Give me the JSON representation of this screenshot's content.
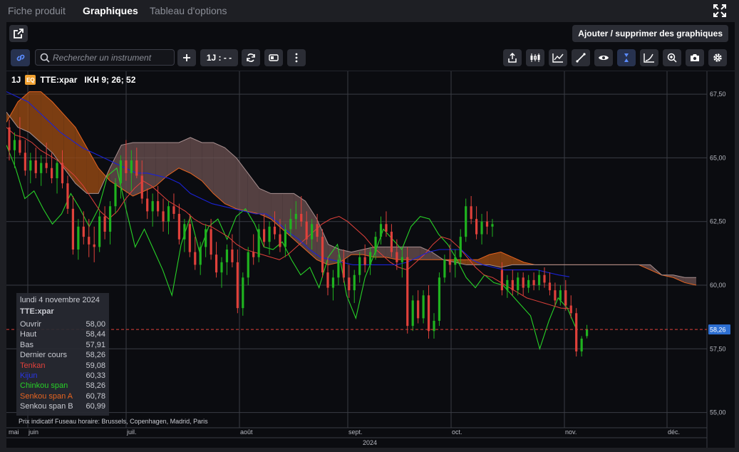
{
  "tabs": [
    {
      "label": "Fiche produit",
      "active": false
    },
    {
      "label": "Graphiques",
      "active": true
    },
    {
      "label": "Tableau d'options",
      "active": false
    }
  ],
  "toolbar": {
    "add_charts_label": "Ajouter / supprimer des graphiques",
    "search_placeholder": "Rechercher un instrument",
    "interval_label": "1J : - -",
    "right_icons": [
      "share-icon",
      "candlestick-type-icon",
      "indicators-icon",
      "draw-line-icon",
      "visibility-icon",
      "crosshair-icon",
      "trend-icon",
      "zoom-icon",
      "screenshot-icon",
      "settings-icon"
    ]
  },
  "chart": {
    "interval": "1J",
    "symbol": "TTE:xpar",
    "symbol_badge": "EQ",
    "indicator": "IKH 9; 26; 52",
    "last_price_label": "58,26",
    "year_label": "2024",
    "footer_note": "Prix indicatif    Fuseau horaire: Brussels, Copenhagen, Madrid, Paris",
    "colors": {
      "candle_up": "#1fb31f",
      "candle_down": "#e0413b",
      "tenkan": "#e0413b",
      "kijun": "#1a22d6",
      "chinkou": "#27d127",
      "senkou_a": "#e76420",
      "senkou_b": "#8d7070",
      "price_line": "#e0413b",
      "price_badge": "#2d6fd2"
    }
  },
  "tooltip": {
    "date": "lundi 4 novembre 2024",
    "symbol": "TTE:xpar",
    "rows": [
      {
        "label": "Ouvrir",
        "value": "58,00",
        "color": "#c9cbd2"
      },
      {
        "label": "Haut",
        "value": "58,44",
        "color": "#c9cbd2"
      },
      {
        "label": "Bas",
        "value": "57,91",
        "color": "#c9cbd2"
      },
      {
        "label": "Dernier cours",
        "value": "58,26",
        "color": "#c9cbd2"
      },
      {
        "label": "Tenkan",
        "value": "59,08",
        "color": "#e0413b"
      },
      {
        "label": "Kijun",
        "value": "60,33",
        "color": "#2a36e8"
      },
      {
        "label": "Chinkou span",
        "value": "58,26",
        "color": "#27d127"
      },
      {
        "label": "Senkou span A",
        "value": "60,78",
        "color": "#e76420"
      },
      {
        "label": "Senkou span B",
        "value": "60,99",
        "color": "#c9cbd2"
      }
    ]
  },
  "chart_data": {
    "type": "candlestick",
    "y_ticks": [
      "67,50",
      "65,00",
      "62,50",
      "60,00",
      "57,50",
      "55,00"
    ],
    "x_ticks": [
      "mai",
      "juin",
      "juil.",
      "août",
      "sept.",
      "oct.",
      "nov.",
      "déc."
    ],
    "ylim": [
      54.4,
      68.4
    ],
    "grid": true,
    "candles_ohlc": [
      [
        66.2,
        66.5,
        64.9,
        65.3
      ],
      [
        65.3,
        66.0,
        64.6,
        65.7
      ],
      [
        65.7,
        66.6,
        65.1,
        65.2
      ],
      [
        65.2,
        65.7,
        64.3,
        64.5
      ],
      [
        64.5,
        65.2,
        64.0,
        64.9
      ],
      [
        64.9,
        65.4,
        64.2,
        64.4
      ],
      [
        64.4,
        65.1,
        63.9,
        64.8
      ],
      [
        64.8,
        65.6,
        64.4,
        64.6
      ],
      [
        64.6,
        65.2,
        64.0,
        64.2
      ],
      [
        64.2,
        64.9,
        63.6,
        64.8
      ],
      [
        64.8,
        65.3,
        63.8,
        64.0
      ],
      [
        64.0,
        64.3,
        62.8,
        63.0
      ],
      [
        63.0,
        63.5,
        61.2,
        61.4
      ],
      [
        61.4,
        62.6,
        61.0,
        62.3
      ],
      [
        62.3,
        62.9,
        61.6,
        61.9
      ],
      [
        61.9,
        62.6,
        61.1,
        61.6
      ],
      [
        61.6,
        62.3,
        60.9,
        61.5
      ],
      [
        61.5,
        62.9,
        61.3,
        62.7
      ],
      [
        62.7,
        63.1,
        61.8,
        62.1
      ],
      [
        62.1,
        63.3,
        61.6,
        63.1
      ],
      [
        63.1,
        64.2,
        62.8,
        64.0
      ],
      [
        64.0,
        65.1,
        63.4,
        64.9
      ],
      [
        64.9,
        65.7,
        64.1,
        64.4
      ],
      [
        64.4,
        65.3,
        63.7,
        64.9
      ],
      [
        64.9,
        65.4,
        64.2,
        64.3
      ],
      [
        64.3,
        64.9,
        63.2,
        63.4
      ],
      [
        63.4,
        63.8,
        62.6,
        62.9
      ],
      [
        62.9,
        63.6,
        62.3,
        63.3
      ],
      [
        63.3,
        63.9,
        62.7,
        62.9
      ],
      [
        62.9,
        63.4,
        62.1,
        62.5
      ],
      [
        62.5,
        63.3,
        62.0,
        63.1
      ],
      [
        63.1,
        63.6,
        62.6,
        62.8
      ],
      [
        62.8,
        63.2,
        61.6,
        61.8
      ],
      [
        61.8,
        62.6,
        61.3,
        62.4
      ],
      [
        62.4,
        62.8,
        61.1,
        61.3
      ],
      [
        61.3,
        61.9,
        60.6,
        60.8
      ],
      [
        60.8,
        61.7,
        60.4,
        61.5
      ],
      [
        61.5,
        62.4,
        61.1,
        62.2
      ],
      [
        62.2,
        62.6,
        61.0,
        61.2
      ],
      [
        61.2,
        61.7,
        60.3,
        60.5
      ],
      [
        60.5,
        61.1,
        59.9,
        60.9
      ],
      [
        60.9,
        61.6,
        60.4,
        61.4
      ],
      [
        61.4,
        62.0,
        60.7,
        60.9
      ],
      [
        60.9,
        61.4,
        58.9,
        59.1
      ],
      [
        59.1,
        60.5,
        58.8,
        60.3
      ],
      [
        60.3,
        61.5,
        60.0,
        61.3
      ],
      [
        61.3,
        62.0,
        60.8,
        61.1
      ],
      [
        61.1,
        62.4,
        60.9,
        62.2
      ],
      [
        62.2,
        62.8,
        61.5,
        61.7
      ],
      [
        61.7,
        62.5,
        61.2,
        62.3
      ],
      [
        62.3,
        62.9,
        61.8,
        62.0
      ],
      [
        62.0,
        62.6,
        61.3,
        61.5
      ],
      [
        61.5,
        62.4,
        61.1,
        62.2
      ],
      [
        62.2,
        63.0,
        61.9,
        62.6
      ],
      [
        62.6,
        63.3,
        62.2,
        62.8
      ],
      [
        62.8,
        63.5,
        62.3,
        62.5
      ],
      [
        62.5,
        62.9,
        61.6,
        61.8
      ],
      [
        61.8,
        62.6,
        61.4,
        62.4
      ],
      [
        62.4,
        62.8,
        61.7,
        61.9
      ],
      [
        61.9,
        62.2,
        60.3,
        60.5
      ],
      [
        60.5,
        61.1,
        59.6,
        59.9
      ],
      [
        59.9,
        60.6,
        59.4,
        60.3
      ],
      [
        60.3,
        61.2,
        60.0,
        61.0
      ],
      [
        61.0,
        61.4,
        60.1,
        60.3
      ],
      [
        60.3,
        60.8,
        59.5,
        59.8
      ],
      [
        59.8,
        60.6,
        59.3,
        60.4
      ],
      [
        60.4,
        61.3,
        60.1,
        61.1
      ],
      [
        61.1,
        61.6,
        60.5,
        60.8
      ],
      [
        60.8,
        61.5,
        60.4,
        61.3
      ],
      [
        61.3,
        62.1,
        61.0,
        61.9
      ],
      [
        61.9,
        62.7,
        61.6,
        62.4
      ],
      [
        62.4,
        62.9,
        61.9,
        62.1
      ],
      [
        62.1,
        62.4,
        61.1,
        61.3
      ],
      [
        61.3,
        61.8,
        60.6,
        60.9
      ],
      [
        60.9,
        61.4,
        60.3,
        61.1
      ],
      [
        61.1,
        61.5,
        58.1,
        58.4
      ],
      [
        58.4,
        59.6,
        58.2,
        59.4
      ],
      [
        59.4,
        59.8,
        58.5,
        58.7
      ],
      [
        58.7,
        59.8,
        58.5,
        59.6
      ],
      [
        59.6,
        60.0,
        57.9,
        58.2
      ],
      [
        58.2,
        58.9,
        57.9,
        58.6
      ],
      [
        58.6,
        60.5,
        58.4,
        60.3
      ],
      [
        60.3,
        61.2,
        60.1,
        61.0
      ],
      [
        61.0,
        61.6,
        60.5,
        60.8
      ],
      [
        60.8,
        61.4,
        60.3,
        61.1
      ],
      [
        61.1,
        62.2,
        60.8,
        61.9
      ],
      [
        61.9,
        63.4,
        61.7,
        63.1
      ],
      [
        63.1,
        63.5,
        62.4,
        62.6
      ],
      [
        62.6,
        63.1,
        61.8,
        62.0
      ],
      [
        62.0,
        62.8,
        61.6,
        62.5
      ],
      [
        62.5,
        62.9,
        62.0,
        62.3
      ],
      [
        62.3,
        62.6,
        61.9,
        62.4
      ],
      [
        60.6,
        60.9,
        59.6,
        59.8
      ],
      [
        59.8,
        60.4,
        59.5,
        60.2
      ],
      [
        60.2,
        60.6,
        59.6,
        59.8
      ],
      [
        59.8,
        60.5,
        59.6,
        60.3
      ],
      [
        60.3,
        60.5,
        59.6,
        59.9
      ],
      [
        59.9,
        60.4,
        59.7,
        60.2
      ],
      [
        60.2,
        60.5,
        59.8,
        60.0
      ],
      [
        60.0,
        60.6,
        59.8,
        60.4
      ],
      [
        60.4,
        60.7,
        59.9,
        60.1
      ],
      [
        60.1,
        60.5,
        59.6,
        59.8
      ],
      [
        59.8,
        60.1,
        59.2,
        59.4
      ],
      [
        59.4,
        60.0,
        59.2,
        59.8
      ],
      [
        59.8,
        60.2,
        59.0,
        59.2
      ],
      [
        59.2,
        59.6,
        58.7,
        58.9
      ],
      [
        58.9,
        59.1,
        57.2,
        57.4
      ],
      [
        57.4,
        58.0,
        57.2,
        57.9
      ],
      [
        58.0,
        58.44,
        57.91,
        58.26
      ]
    ],
    "tenkan": [
      66.2,
      65.9,
      65.8,
      65.6,
      65.3,
      65.1,
      64.9,
      64.6,
      64.3,
      63.9,
      63.4,
      62.9,
      62.6,
      62.9,
      63.4,
      63.8,
      64.1,
      63.9,
      63.6,
      63.3,
      63.1,
      62.9,
      62.6,
      62.4,
      62.3,
      62.1,
      61.9,
      61.6,
      61.4,
      61.3,
      61.2,
      61.1,
      61.0,
      61.2,
      61.5,
      61.8,
      62.1,
      62.4,
      62.6,
      62.7,
      62.5,
      62.2,
      61.9,
      61.5,
      61.2,
      60.9,
      60.7,
      60.6,
      60.9,
      61.2,
      61.6,
      61.9,
      61.8,
      61.5,
      61.1,
      60.7,
      60.4,
      60.3,
      60.1,
      59.9,
      59.7,
      59.5,
      59.4,
      59.3,
      59.2,
      59.1,
      59.08
    ],
    "kijun": [
      67.6,
      67.4,
      67.2,
      66.8,
      66.4,
      66.0,
      65.7,
      65.4,
      65.2,
      65.0,
      64.8,
      64.6,
      64.4,
      64.4,
      64.3,
      64.2,
      64.0,
      63.6,
      63.4,
      63.2,
      63.1,
      63.0,
      62.9,
      62.8,
      62.8,
      62.5,
      62.1,
      61.8,
      61.4,
      61.1,
      61.0,
      60.9,
      60.8,
      60.8,
      60.8,
      60.8,
      60.8,
      60.9,
      61.1,
      61.3,
      61.4,
      61.4,
      61.4,
      61.0,
      60.8,
      60.7,
      60.6,
      60.6,
      60.6,
      60.6,
      60.5,
      60.4,
      60.33
    ],
    "chinkou": [
      65.5,
      64.6,
      63.4,
      63.7,
      63.0,
      62.4,
      62.8,
      63.6,
      63.0,
      62.3,
      63.0,
      64.3,
      64.6,
      63.0,
      61.5,
      62.2,
      61.4,
      60.6,
      59.6,
      61.6,
      62.7,
      61.3,
      62.3,
      62.6,
      61.8,
      62.7,
      63.0,
      62.4,
      61.5,
      61.4,
      61.7,
      61.0,
      60.4,
      60.7,
      59.9,
      61.1,
      61.6,
      59.6,
      58.7,
      60.3,
      61.2,
      62.2,
      61.8,
      61.4,
      62.3,
      62.7,
      62.6,
      62.0,
      61.6,
      61.0,
      60.3,
      59.9,
      60.4,
      60.1,
      60.0,
      59.6,
      59.2,
      58.8,
      57.5,
      58.6,
      59.5,
      59.1,
      58.26
    ],
    "senkou_a": [
      66.4,
      67.2,
      67.6,
      67.6,
      67.2,
      66.7,
      66.2,
      65.4,
      64.6,
      64.1,
      63.8,
      63.5,
      63.7,
      63.9,
      64.3,
      64.6,
      64.4,
      64.1,
      63.6,
      63.2,
      63.0,
      62.9,
      62.8,
      62.6,
      62.2,
      61.8,
      61.4,
      61.0,
      60.8,
      60.9,
      61.2,
      61.2,
      61.1,
      61.1,
      61.0,
      61.0,
      61.0,
      61.0,
      61.0,
      61.0,
      61.0,
      61.0,
      61.2,
      61.3,
      61.1,
      60.9,
      60.8,
      60.8,
      60.8,
      60.8,
      60.8,
      60.8,
      60.8,
      60.8,
      60.8,
      60.8,
      60.6,
      60.4,
      60.3,
      60.1,
      60.0
    ],
    "senkou_b": [
      66.8,
      66.2,
      66.0,
      65.6,
      65.2,
      64.6,
      64.0,
      63.6,
      63.6,
      64.6,
      65.5,
      65.6,
      65.6,
      65.6,
      65.6,
      65.6,
      65.8,
      65.6,
      65.6,
      65.4,
      65.0,
      64.4,
      63.8,
      63.6,
      63.6,
      63.6,
      63.3,
      62.6,
      61.6,
      61.4,
      61.3,
      61.4,
      61.5,
      61.5,
      61.5,
      61.5,
      61.5,
      61.3,
      61.0,
      60.9,
      60.8,
      60.8,
      60.8,
      60.7,
      60.8,
      60.8,
      60.8,
      60.8,
      60.8,
      60.8,
      60.8,
      60.8,
      60.8,
      60.8,
      60.8,
      60.8,
      60.8,
      60.4,
      60.4,
      60.3,
      60.3
    ]
  }
}
